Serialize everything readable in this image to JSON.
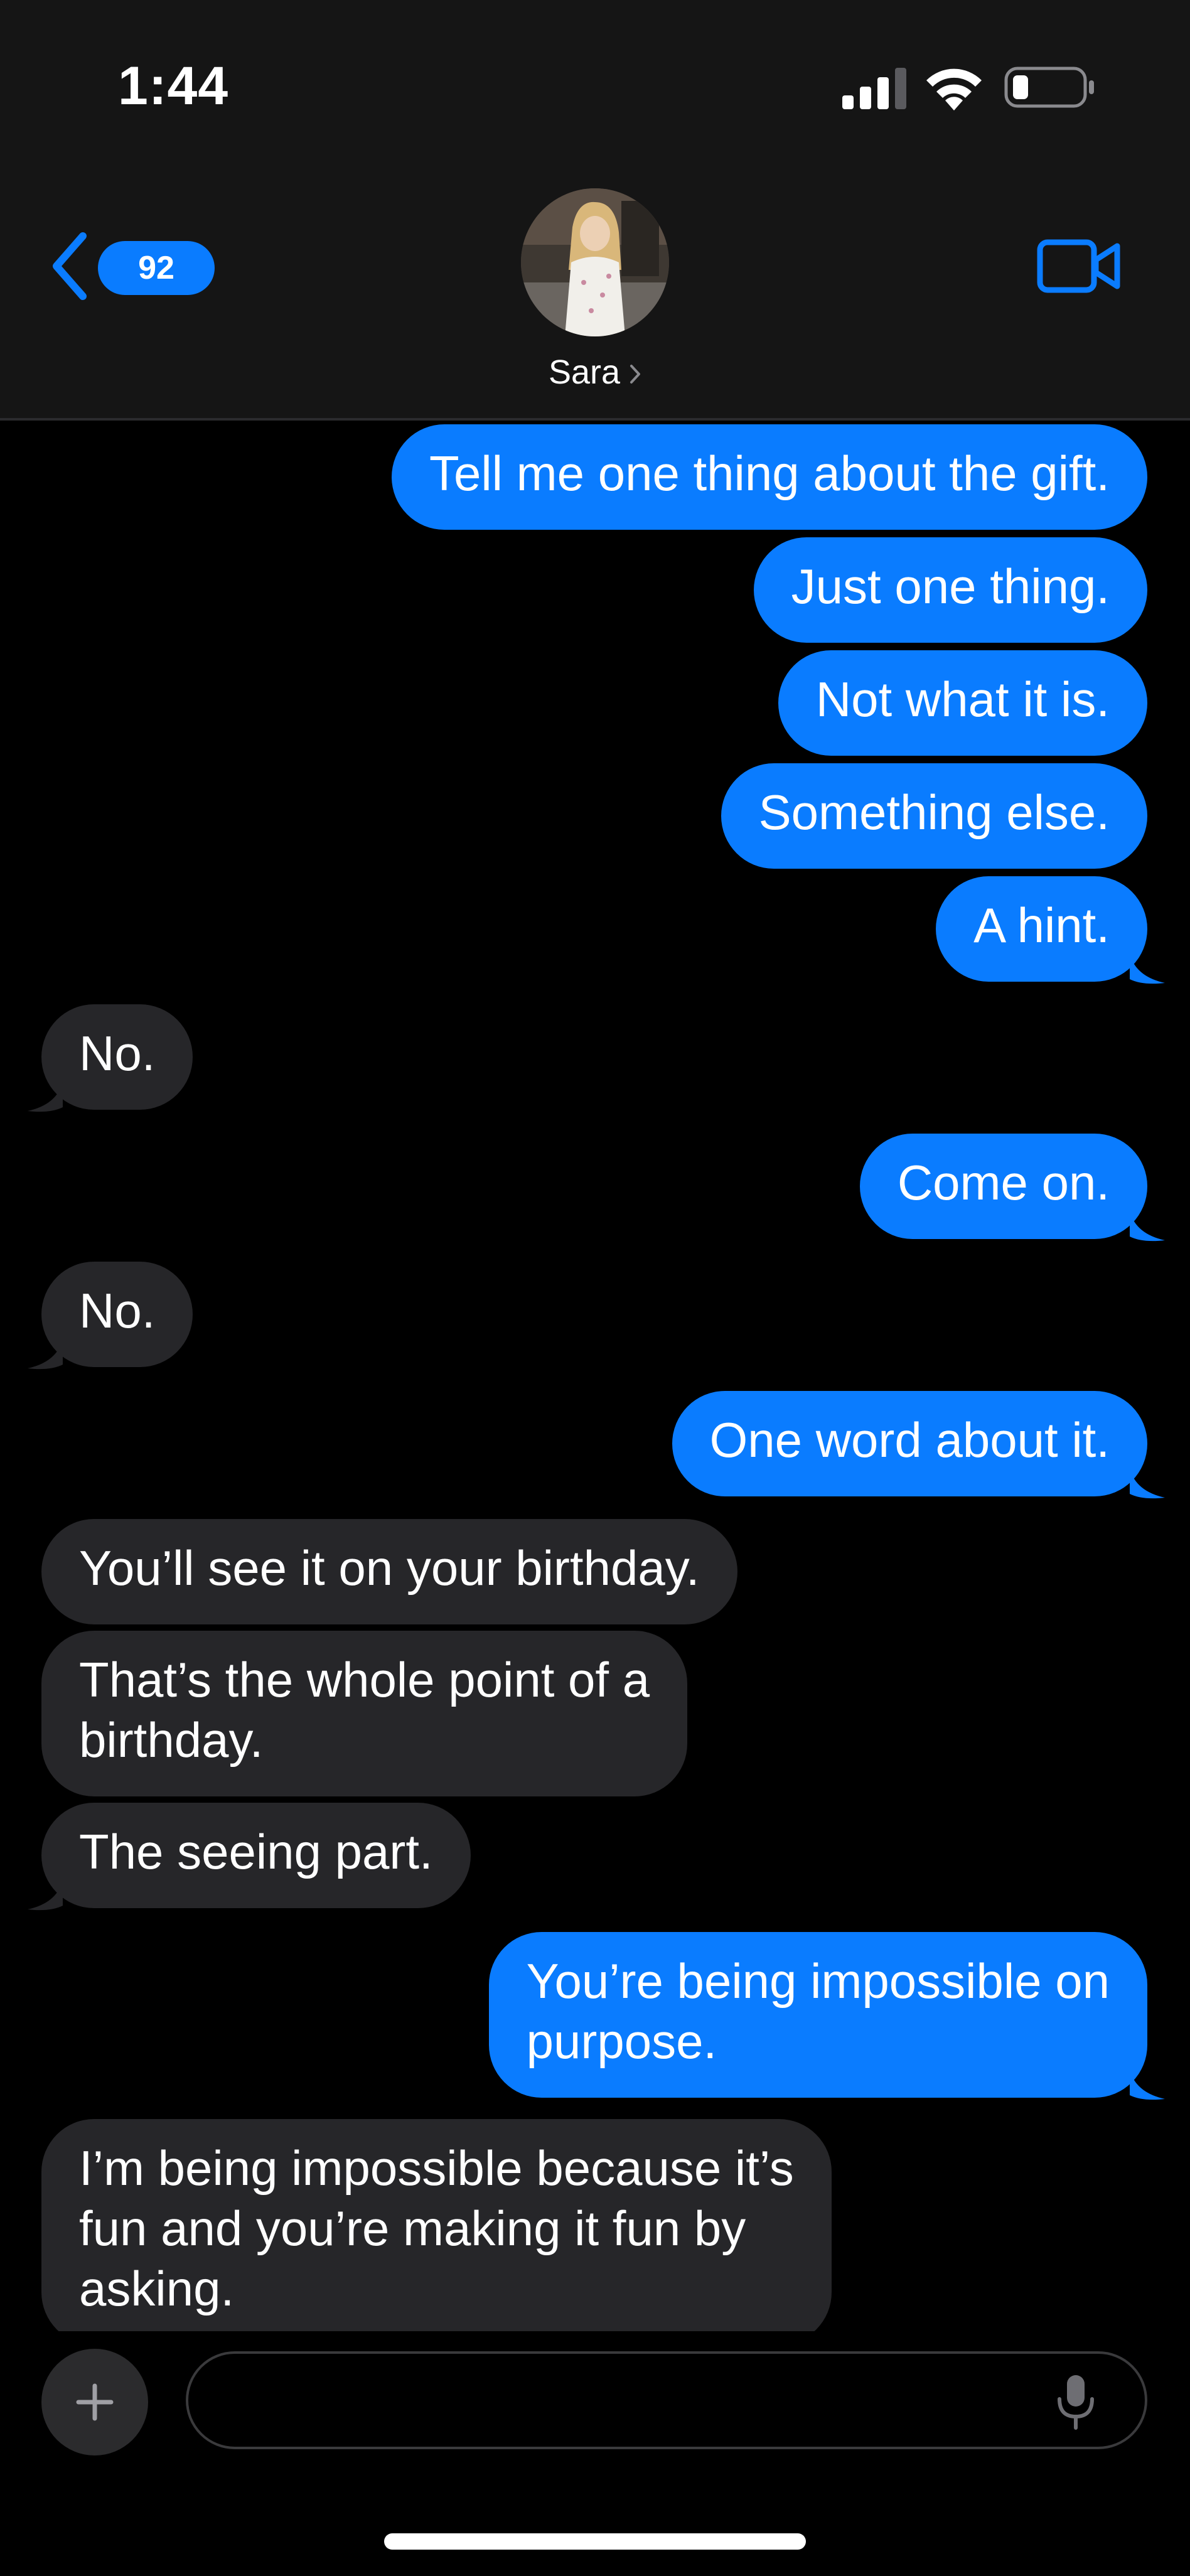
{
  "status_bar": {
    "time": "1:44"
  },
  "header": {
    "back_badge": "92",
    "contact_name": "Sara"
  },
  "colors": {
    "sent_bubble": "#0a7cff",
    "received_bubble": "#262629",
    "accent": "#0a7cff"
  },
  "messages": [
    {
      "from": "me",
      "text": "Tell me one thing about the gift."
    },
    {
      "from": "me",
      "text": "Just one thing."
    },
    {
      "from": "me",
      "text": "Not what it is."
    },
    {
      "from": "me",
      "text": "Something else."
    },
    {
      "from": "me",
      "text": "A hint."
    },
    {
      "from": "them",
      "text": "No."
    },
    {
      "from": "me",
      "text": "Come on."
    },
    {
      "from": "them",
      "text": "No."
    },
    {
      "from": "me",
      "text": "One word about it."
    },
    {
      "from": "them",
      "text": "You’ll see it on your birthday."
    },
    {
      "from": "them",
      "text": "That’s the whole point of a\nbirthday."
    },
    {
      "from": "them",
      "text": "The seeing part."
    },
    {
      "from": "me",
      "text": "You’re being impossible on\npurpose."
    },
    {
      "from": "them",
      "text": "I’m being impossible because it’s\nfun and you’re making it fun by\nasking."
    }
  ],
  "composer": {
    "input_value": "",
    "placeholder": ""
  },
  "icons": {
    "back": "chevron-left-icon",
    "video": "video-camera-icon",
    "plus": "plus-icon",
    "mic": "microphone-icon",
    "signal": "cellular-signal-icon",
    "wifi": "wifi-icon",
    "battery": "battery-icon"
  }
}
